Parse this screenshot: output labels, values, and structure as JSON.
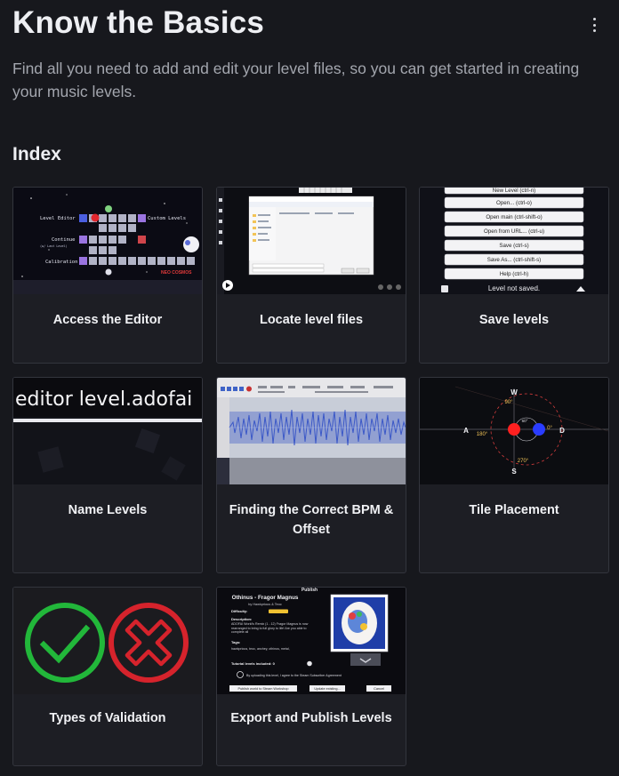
{
  "header": {
    "title": "Know the Basics",
    "subtitle": "Find all you need to add and edit your level files, so you can get started in creating your music levels."
  },
  "index": {
    "title": "Index",
    "cards": [
      {
        "label": "Access the Editor",
        "thumb": {
          "level_editor": "Level Editor",
          "custom_levels": "Custom Levels",
          "continue": "Continue",
          "continue_sub": "(w/ Last Level)",
          "calibration": "Calibration",
          "brand": "NEO COSMOS"
        }
      },
      {
        "label": "Locate level files"
      },
      {
        "label": "Save levels",
        "thumb": {
          "menu_items": [
            "New Level (ctrl-n)",
            "Open... (ctrl-o)",
            "Open main (ctrl-shift-o)",
            "Open from URL... (ctrl-u)",
            "Save (ctrl-s)",
            "Save As... (ctrl-shift-s)",
            "Help (ctrl-h)"
          ],
          "status": "Level not saved."
        }
      },
      {
        "label": "Name Levels",
        "thumb": {
          "filename": "editor level.adofai"
        }
      },
      {
        "label": "Finding the Correct BPM & Offset"
      },
      {
        "label": "Tile Placement",
        "thumb": {
          "dir_w": "W",
          "dir_a": "A",
          "dir_s": "S",
          "dir_d": "D",
          "angle_90": "90°",
          "angle_180": "180°",
          "angle_270": "270°",
          "angle_0": "0°",
          "angle_60": "60°"
        }
      },
      {
        "label": "Types of Validation"
      },
      {
        "label": "Export and Publish Levels",
        "thumb": {
          "heading": "Publish",
          "song": "Othinus - Fragor Magnus",
          "by": "by Hawkprious & Teoc",
          "difficulty_label": "Difficulty:",
          "description_label": "Description:",
          "description": "ADOFAI World's Remix (1 - 12) Fragor Magnus is now rearranged to bring to full glory to life! Are you able to complete all",
          "tags_label": "Tags:",
          "tags": "hawkprious, teoc, anchey, othinus, metal,",
          "tutorial_label": "Tutorial levels included: 0",
          "agreement": "By uploading this level, I agree to the Steam Subscriber Agreement",
          "publish_button": "Publish world to Steam Workshop",
          "update_button": "Update existing...",
          "cancel_button": "Cancel"
        }
      }
    ]
  },
  "colors": {
    "background": "#17181d",
    "card": "#1d1e24",
    "border": "#33353d",
    "check": "#22b73a",
    "cross": "#d6232c"
  }
}
